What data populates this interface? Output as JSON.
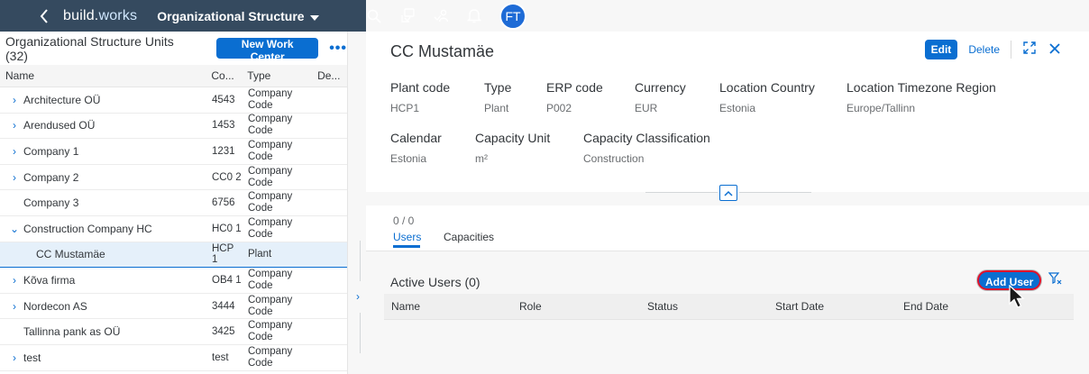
{
  "shell": {
    "logo_prefix": "build.",
    "logo_suffix": "works",
    "app_title": "Organizational Structure",
    "avatar_initials": "FT",
    "icons": [
      "search-icon",
      "work-items-icon",
      "people-icon",
      "bell-icon"
    ]
  },
  "left": {
    "title": "Organizational Structure Units (32)",
    "new_button": "New Work Center",
    "more": "•••",
    "columns": {
      "name": "Name",
      "code": "Co...",
      "type": "Type",
      "desc": "De..."
    },
    "rows": [
      {
        "name": "Architecture OÜ",
        "expand": "›",
        "code": "4543",
        "type": "Company Code"
      },
      {
        "name": "Arendused OÜ",
        "expand": "›",
        "code": "1453",
        "type": "Company Code"
      },
      {
        "name": "Company 1",
        "expand": "›",
        "code": "1231",
        "type": "Company Code"
      },
      {
        "name": "Company 2",
        "expand": "›",
        "code": "CC0 2",
        "type": "Company Code"
      },
      {
        "name": "Company 3",
        "expand": "",
        "code": "6756",
        "type": "Company Code"
      },
      {
        "name": "Construction Company HC",
        "expand": "⌄",
        "code": "HC0 1",
        "type": "Company Code"
      },
      {
        "name": "CC Mustamäe",
        "expand": "",
        "code": "HCP 1",
        "type": "Plant",
        "selected": true,
        "child": true
      },
      {
        "name": "Kõva firma",
        "expand": "›",
        "code": "OB4 1",
        "type": "Company Code"
      },
      {
        "name": "Nordecon AS",
        "expand": "›",
        "code": "3444",
        "type": "Company Code"
      },
      {
        "name": "Tallinna pank as OÜ",
        "expand": "",
        "code": "3425",
        "type": "Company Code"
      },
      {
        "name": "test",
        "expand": "›",
        "code": "test",
        "type": "Company Code"
      }
    ]
  },
  "object": {
    "title": "CC Mustamäe",
    "edit": "Edit",
    "delete": "Delete",
    "attributes": {
      "plant_code": {
        "label": "Plant code",
        "value": "HCP1"
      },
      "type": {
        "label": "Type",
        "value": "Plant"
      },
      "erp_code": {
        "label": "ERP code",
        "value": "P002"
      },
      "currency": {
        "label": "Currency",
        "value": "EUR"
      },
      "location_country": {
        "label": "Location Country",
        "value": "Estonia"
      },
      "timezone": {
        "label": "Location Timezone Region",
        "value": "Europe/Tallinn"
      },
      "calendar": {
        "label": "Calendar",
        "value": "Estonia"
      },
      "capacity_unit": {
        "label": "Capacity Unit",
        "value": "m²"
      },
      "capacity_class": {
        "label": "Capacity Classification",
        "value": "Construction"
      }
    }
  },
  "tabs": [
    {
      "count": "0 / 0",
      "label": "Users",
      "active": true
    },
    {
      "count": "",
      "label": "Capacities",
      "active": false
    }
  ],
  "users": {
    "title": "Active Users (0)",
    "add_button": "Add User",
    "columns": [
      "Name",
      "Role",
      "Status",
      "Start Date",
      "End Date"
    ]
  },
  "colors": {
    "shell": "#354a5f",
    "accent": "#0a6ed1",
    "highlight": "#e0102b"
  }
}
